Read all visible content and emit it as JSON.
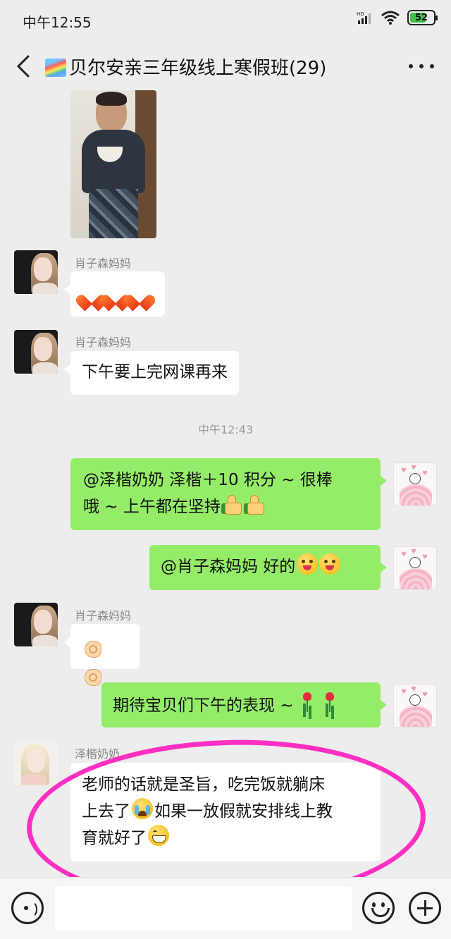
{
  "status_bar": {
    "time": "中午12:55",
    "battery": "52",
    "network_label": "HD"
  },
  "header": {
    "title": "贝尔安亲三年级线上寒假班(29)",
    "title_icon": "rainbow-icon"
  },
  "messages": [
    {
      "type": "image",
      "side": "left",
      "content": "boy-holding-bowl-photo"
    },
    {
      "sender": "肖子森妈妈",
      "side": "left",
      "text": "",
      "emojis": [
        "heart-icon",
        "heart-icon",
        "heart-icon"
      ]
    },
    {
      "sender": "肖子森妈妈",
      "side": "left",
      "text": "下午要上完网课再来"
    },
    {
      "type": "timestamp",
      "text": "中午12:43"
    },
    {
      "side": "right",
      "text": "@泽楷奶奶  泽楷＋10 积分 ~ 很棒哦 ~ 上午都在坚持",
      "emojis": [
        "thumbs-up-icon",
        "thumbs-up-icon"
      ]
    },
    {
      "side": "right",
      "text": "@肖子森妈妈  好的",
      "emojis": [
        "tongue-wink-icon",
        "tongue-wink-icon"
      ]
    },
    {
      "sender": "肖子森妈妈",
      "side": "left",
      "text": "",
      "emojis": [
        "ok-hand-icon",
        "handshake-icon"
      ]
    },
    {
      "side": "right",
      "text": "期待宝贝们下午的表现 ~",
      "emojis": [
        "rose-icon",
        "rose-icon"
      ]
    },
    {
      "sender": "泽楷奶奶",
      "side": "left",
      "text_parts": [
        "老师的话就是圣旨，吃完饭就躺床上去了",
        "如果一放假就安排线上教育就好了"
      ],
      "emojis": [
        "crying-laughing-icon",
        "grinning-icon"
      ]
    }
  ],
  "bubble_lines": {
    "zekai_line1": "@泽楷奶奶  泽楷＋10 积分 ~ 很棒",
    "zekai_line2": "哦 ~ 上午都在坚持",
    "last_line1": "老师的话就是圣旨，吃完饭就躺床",
    "last_line2_a": "上去了",
    "last_line2_b": "如果一放假就安排线上教",
    "last_line3": "育就好了"
  },
  "colors": {
    "background": "#ededed",
    "bubble_self": "#95ec69",
    "bubble_other": "#ffffff",
    "annotation": "#ff2fc2"
  }
}
